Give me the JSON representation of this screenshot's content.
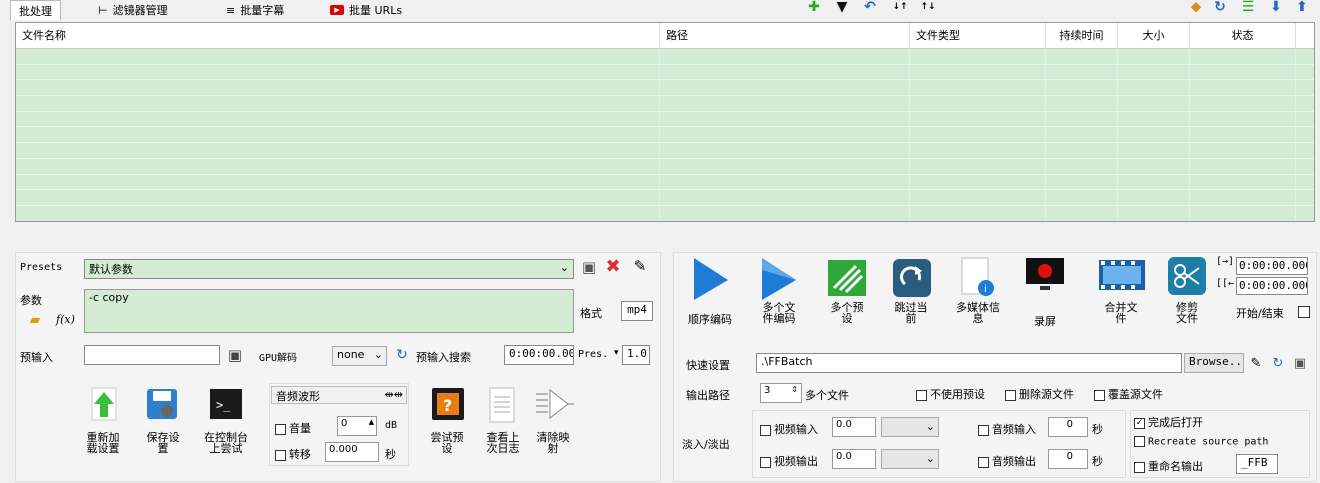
{
  "tabs": [
    {
      "label": "批处理",
      "icon": "batch-icon"
    },
    {
      "label": "滤镜器管理",
      "icon": "filter-tree-icon"
    },
    {
      "label": "批量字幕",
      "icon": "subtitle-icon"
    },
    {
      "label": "批量 URLs",
      "icon": "youtube-icon"
    }
  ],
  "grid": {
    "columns": [
      "文件名称",
      "路径",
      "文件类型",
      "持续时间",
      "大小",
      "状态"
    ]
  },
  "presets": {
    "label": "Presets",
    "value": "默认参数",
    "params_label": "参数",
    "params_value": "-c copy",
    "format_label": "格式",
    "format_value": "mp4"
  },
  "preinput": {
    "label": "预输入",
    "value": "",
    "gpu_label": "GPU解码",
    "gpu_value": "none",
    "search_label": "预输入搜索",
    "time_value": "0:00:00.000",
    "pres_label": "Pres.",
    "pres_value": "1.0"
  },
  "audio": {
    "waveform_label": "音频波形",
    "volume_label": "音量",
    "volume_value": "0",
    "db": "dB",
    "shift_label": "转移",
    "shift_value": "0.000",
    "sec": "秒"
  },
  "left_buttons": [
    {
      "label": "重新加\n载设置",
      "icon": "reload-arrow-icon"
    },
    {
      "label": "保存设\n置",
      "icon": "save-settings-icon"
    },
    {
      "label": "在控制台\n上尝试",
      "icon": "console-icon"
    },
    {
      "label": "尝试预\n设",
      "icon": "help-icon"
    },
    {
      "label": "查看上\n次日志",
      "icon": "log-icon"
    },
    {
      "label": "清除映\n射",
      "icon": "map-icon"
    }
  ],
  "actions": [
    {
      "label": "顺序编码",
      "icon": "play-icon"
    },
    {
      "label": "多个文\n件编码",
      "icon": "multi-play-icon"
    },
    {
      "label": "多个预\n设",
      "icon": "multi-preset-icon"
    },
    {
      "label": "跳过当\n前",
      "icon": "skip-icon"
    },
    {
      "label": "多媒体信\n息",
      "icon": "media-info-icon"
    },
    {
      "label": "录屏",
      "icon": "record-screen-icon"
    },
    {
      "label": "合并文\n件",
      "icon": "merge-film-icon"
    },
    {
      "label": "修剪\n文件",
      "icon": "scissors-icon"
    }
  ],
  "trim": {
    "start_prefix": "[→]",
    "start_value": "0:00:00.000",
    "end_prefix": "[[←",
    "end_value": "0:00:00.000",
    "startend_label": "开始/结束"
  },
  "quick": {
    "label": "快速设置",
    "value": ".\\FFBatch",
    "browse": "Browse..."
  },
  "output": {
    "label": "输出路径",
    "count": "3",
    "multi_label": "多个文件",
    "no_preset": "不使用预设",
    "delete_src": "删除源文件",
    "overwrite_src": "覆盖源文件"
  },
  "fade": {
    "label": "淡入/淡出",
    "video_in": "视频输入",
    "video_out": "视频输出",
    "video_in_value": "0.0",
    "video_out_value": "0.0",
    "audio_in": "音频输入",
    "audio_out": "音频输出",
    "audio_in_value": "0",
    "audio_out_value": "0",
    "sec": "秒"
  },
  "finish": {
    "open_after": "完成后打开",
    "recreate": "Recreate source path",
    "rename": "重命名输出",
    "suffix": "_FFB"
  },
  "colors": {
    "accent_green": "#d4ecd4",
    "play_blue": "#1e7bd6"
  }
}
